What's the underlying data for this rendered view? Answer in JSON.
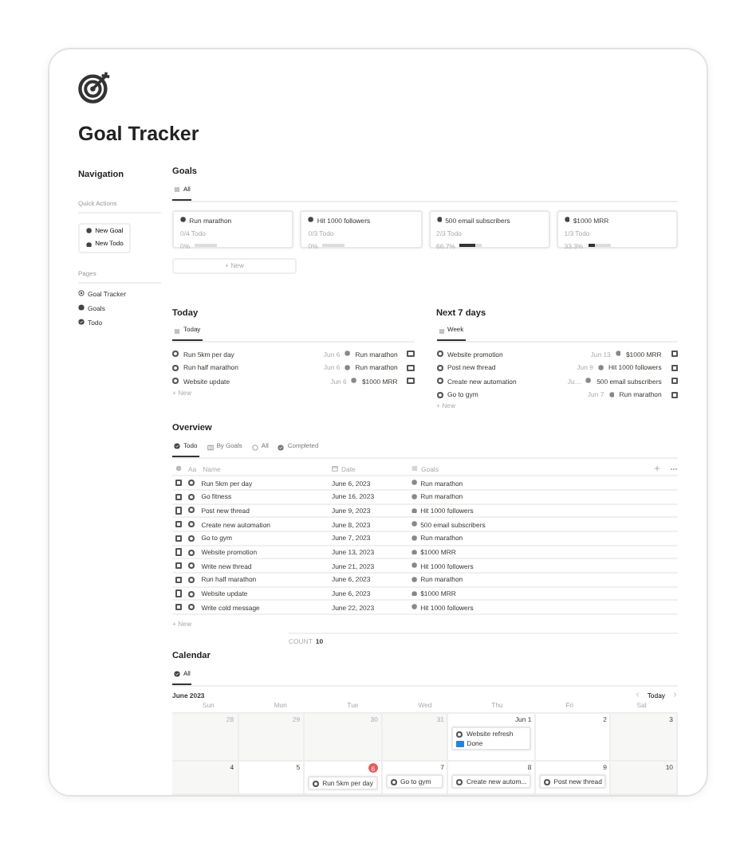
{
  "page": {
    "title": "Goal Tracker"
  },
  "sidebar": {
    "heading": "Navigation",
    "quick_actions": {
      "label": "Quick Actions",
      "items": [
        "New Goal",
        "New Todo"
      ]
    },
    "pages": {
      "label": "Pages",
      "items": [
        {
          "label": "Goal Tracker",
          "kind": "tracker"
        },
        {
          "label": "Goals",
          "kind": "goal"
        },
        {
          "label": "Todo",
          "kind": "todo"
        }
      ]
    }
  },
  "goals": {
    "heading": "Goals",
    "tabs": [
      {
        "label": "All",
        "selected": true
      }
    ],
    "cards": [
      {
        "name": "Run marathon",
        "todos": "0/4 Todo",
        "percent": "0%",
        "level": 0
      },
      {
        "name": "Hit 1000 followers",
        "todos": "0/3 Todo",
        "percent": "0%",
        "level": 0
      },
      {
        "name": "500 email subscribers",
        "todos": "2/3 Todo",
        "percent": "66.7%",
        "level": 0.667
      },
      {
        "name": "$1000 MRR",
        "todos": "1/3 Todo",
        "percent": "33.3%",
        "level": 0.333
      }
    ],
    "new": "+ New"
  },
  "lists": [
    {
      "heading": "Today",
      "tabs": [
        {
          "label": "Today",
          "selected": true
        }
      ],
      "rows": [
        {
          "name": "Run 5km per day",
          "date": "Jun 6",
          "goal": "Run marathon",
          "checked": false
        },
        {
          "name": "Run half marathon",
          "date": "Jun 6",
          "goal": "Run marathon",
          "checked": false
        },
        {
          "name": "Website update",
          "date": "Jun 6",
          "goal": "$1000 MRR",
          "checked": false
        }
      ],
      "new": "+ New"
    },
    {
      "heading": "Next 7 days",
      "tabs": [
        {
          "label": "Week",
          "selected": true
        }
      ],
      "rows": [
        {
          "name": "Website promotion",
          "date": "Jun 13",
          "goal": "$1000 MRR",
          "checked": false
        },
        {
          "name": "Post new thread",
          "date": "Jun 9",
          "goal": "Hit 1000 followers",
          "checked": false
        },
        {
          "name": "Create new automation",
          "date": "Ju…",
          "goal": "500 email subscribers",
          "checked": false
        },
        {
          "name": "Go to gym",
          "date": "Jun 7",
          "goal": "Run marathon",
          "checked": false
        }
      ],
      "new": "+ New"
    }
  ],
  "overview": {
    "heading": "Overview",
    "tabs": [
      {
        "label": "Todo",
        "kind": "todo",
        "selected": true
      },
      {
        "label": "By Goals",
        "kind": "board",
        "selected": false
      },
      {
        "label": "All",
        "kind": "circle",
        "selected": false
      },
      {
        "label": "Completed",
        "kind": "done",
        "selected": false
      }
    ],
    "columns": [
      {
        "label": "Name",
        "prefix": "Aa",
        "kind": "text"
      },
      {
        "label": "Date",
        "kind": "date"
      },
      {
        "label": "Goals",
        "kind": "relation"
      }
    ],
    "rows": [
      {
        "name": "Run 5km per day",
        "date": "June 6, 2023",
        "goal": "Run marathon",
        "checked": false
      },
      {
        "name": "Go fitness",
        "date": "June 16, 2023",
        "goal": "Run marathon",
        "checked": false
      },
      {
        "name": "Post new thread",
        "date": "June 9, 2023",
        "goal": "Hit 1000 followers",
        "checked": false
      },
      {
        "name": "Create new automation",
        "date": "June 8, 2023",
        "goal": "500 email subscribers",
        "checked": false
      },
      {
        "name": "Go to gym",
        "date": "June 7, 2023",
        "goal": "Run marathon",
        "checked": false
      },
      {
        "name": "Website promotion",
        "date": "June 13, 2023",
        "goal": "$1000 MRR",
        "checked": false
      },
      {
        "name": "Write new thread",
        "date": "June 21, 2023",
        "goal": "Hit 1000 followers",
        "checked": false
      },
      {
        "name": "Run half marathon",
        "date": "June 6, 2023",
        "goal": "Run marathon",
        "checked": false
      },
      {
        "name": "Website update",
        "date": "June 6, 2023",
        "goal": "$1000 MRR",
        "checked": false
      },
      {
        "name": "Write cold message",
        "date": "June 22, 2023",
        "goal": "Hit 1000 followers",
        "checked": false
      }
    ],
    "new": "+ New",
    "count_label": "COUNT",
    "count": "10"
  },
  "calendar": {
    "heading": "Calendar",
    "tabs": [
      {
        "label": "All",
        "selected": true
      }
    ],
    "month": "June 2023",
    "today_button": "Today",
    "weekdays": [
      "Sun",
      "Mon",
      "Tue",
      "Wed",
      "Thu",
      "Fri",
      "Sat"
    ],
    "weeks": [
      [
        {
          "day": "28",
          "outside": true
        },
        {
          "day": "29",
          "outside": true
        },
        {
          "day": "30",
          "outside": true
        },
        {
          "day": "31",
          "outside": true
        },
        {
          "day": "Jun 1",
          "outside": false,
          "events": [
            {
              "title": "Website refresh",
              "status": "Done",
              "done": true
            }
          ]
        },
        {
          "day": "2",
          "outside": false
        },
        {
          "day": "3",
          "outside": false
        }
      ],
      [
        {
          "day": "4",
          "outside": false
        },
        {
          "day": "5",
          "outside": false
        },
        {
          "day": "6",
          "outside": false,
          "today": true,
          "events": [
            {
              "title": "Run 5km per day"
            }
          ]
        },
        {
          "day": "7",
          "outside": false,
          "events": [
            {
              "title": "Go to gym"
            }
          ]
        },
        {
          "day": "8",
          "outside": false,
          "events": [
            {
              "title": "Create new autom..."
            }
          ]
        },
        {
          "day": "9",
          "outside": false,
          "events": [
            {
              "title": "Post new thread"
            }
          ]
        },
        {
          "day": "10",
          "outside": false
        }
      ]
    ]
  }
}
